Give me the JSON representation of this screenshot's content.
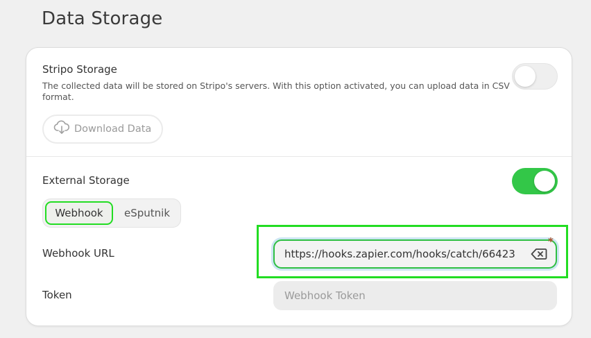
{
  "page": {
    "title": "Data Storage"
  },
  "stripo_storage": {
    "title": "Stripo Storage",
    "description": "The collected data will be stored on Stripo's servers. With this option activated, you can upload data in CSV format.",
    "toggle_on": false,
    "download_label": "Download Data",
    "download_icon": "cloud-download-icon"
  },
  "external_storage": {
    "title": "External Storage",
    "toggle_on": true,
    "tabs": [
      {
        "label": "Webhook",
        "active": true
      },
      {
        "label": "eSputnik",
        "active": false
      }
    ],
    "webhook_url": {
      "label": "Webhook URL",
      "value": "https://hooks.zapier.com/hooks/catch/66423",
      "required_mark": "*",
      "clear_icon": "backspace-clear-icon"
    },
    "token": {
      "label": "Token",
      "placeholder": "Webhook Token",
      "value": ""
    }
  },
  "colors": {
    "toggle_on": "#33c748",
    "highlight": "#22dd22",
    "input_focus_border": "#2fbf44",
    "required": "#b0522d"
  }
}
